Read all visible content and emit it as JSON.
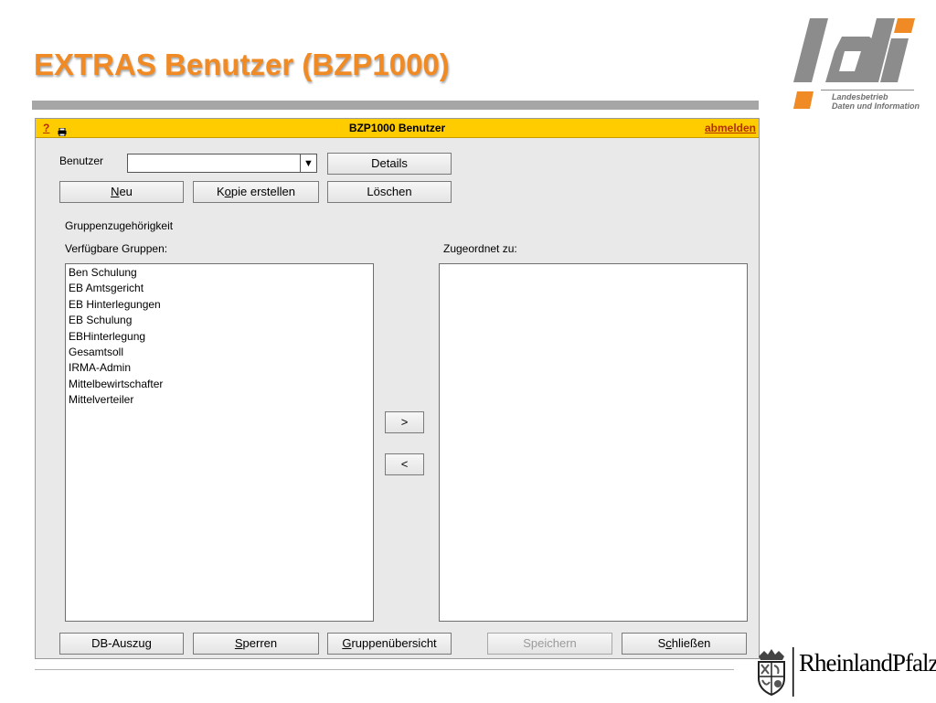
{
  "slide": {
    "title": "EXTRAS Benutzer (BZP1000)"
  },
  "ldi_logo": {
    "line1": "Landesbetrieb",
    "line2": "Daten und Information",
    "colors": {
      "gray": "#8c8c8c",
      "orange": "#f08a24"
    }
  },
  "window": {
    "help": "?",
    "title": "BZP1000 Benutzer",
    "logout": "abmelden",
    "accent_color": "#ffcc00"
  },
  "form": {
    "benutzer_label": "Benutzer",
    "benutzer_value": "",
    "details": "Details",
    "neu": "Neu",
    "kopie": "Kopie erstellen",
    "loeschen": "Löschen",
    "section_label": "Gruppenzugehörigkeit",
    "available_label": "Verfügbare Gruppen:",
    "assigned_label": "Zugeordnet zu:",
    "add": ">",
    "remove": "<",
    "available_groups": [
      "Ben Schulung",
      "EB Amtsgericht",
      "EB Hinterlegungen",
      "EB Schulung",
      "EBHinterlegung",
      "Gesamtsoll",
      "IRMA-Admin",
      "Mittelbewirtschafter",
      "Mittelverteiler"
    ],
    "assigned_groups": []
  },
  "bottom_buttons": {
    "db_auszug": "DB-Auszug",
    "sperren": "Sperren",
    "gruppenuebersicht": "Gruppenübersicht",
    "speichern": "Speichern",
    "schliessen": "Schließen"
  },
  "rlp_logo": {
    "text": "RheinlandPfalz"
  }
}
